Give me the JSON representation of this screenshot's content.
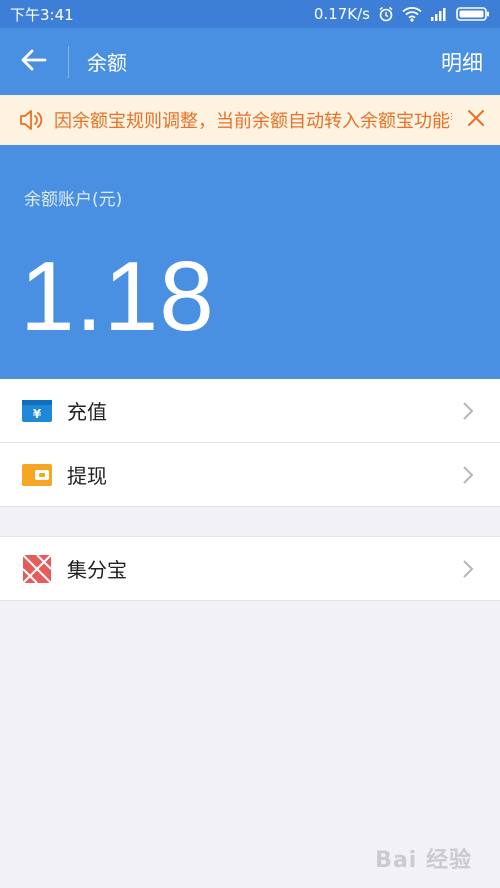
{
  "status_bar": {
    "time": "下午3:41",
    "network_speed": "0.17K/s"
  },
  "nav": {
    "title": "余额",
    "detail_label": "明细"
  },
  "notice": {
    "text": "因余额宝规则调整，当前余额自动转入余额宝功能暂停"
  },
  "balance": {
    "label": "余额账户(元)",
    "value": "1.18"
  },
  "actions": [
    {
      "label": "充值",
      "icon": "wallet-yuan-icon"
    },
    {
      "label": "提现",
      "icon": "wallet-card-icon"
    }
  ],
  "extra": [
    {
      "label": "集分宝",
      "icon": "jifenbao-icon"
    }
  ],
  "watermark": "Bai 经验",
  "colors": {
    "primary_blue": "#4a90e2",
    "status_blue": "#3d7fd6",
    "notice_bg": "#fdf3e0",
    "notice_text": "#e8702a",
    "recharge_icon": "#1e88d9",
    "withdraw_icon": "#f5a623",
    "jifenbao_icon": "#e85b5b"
  }
}
